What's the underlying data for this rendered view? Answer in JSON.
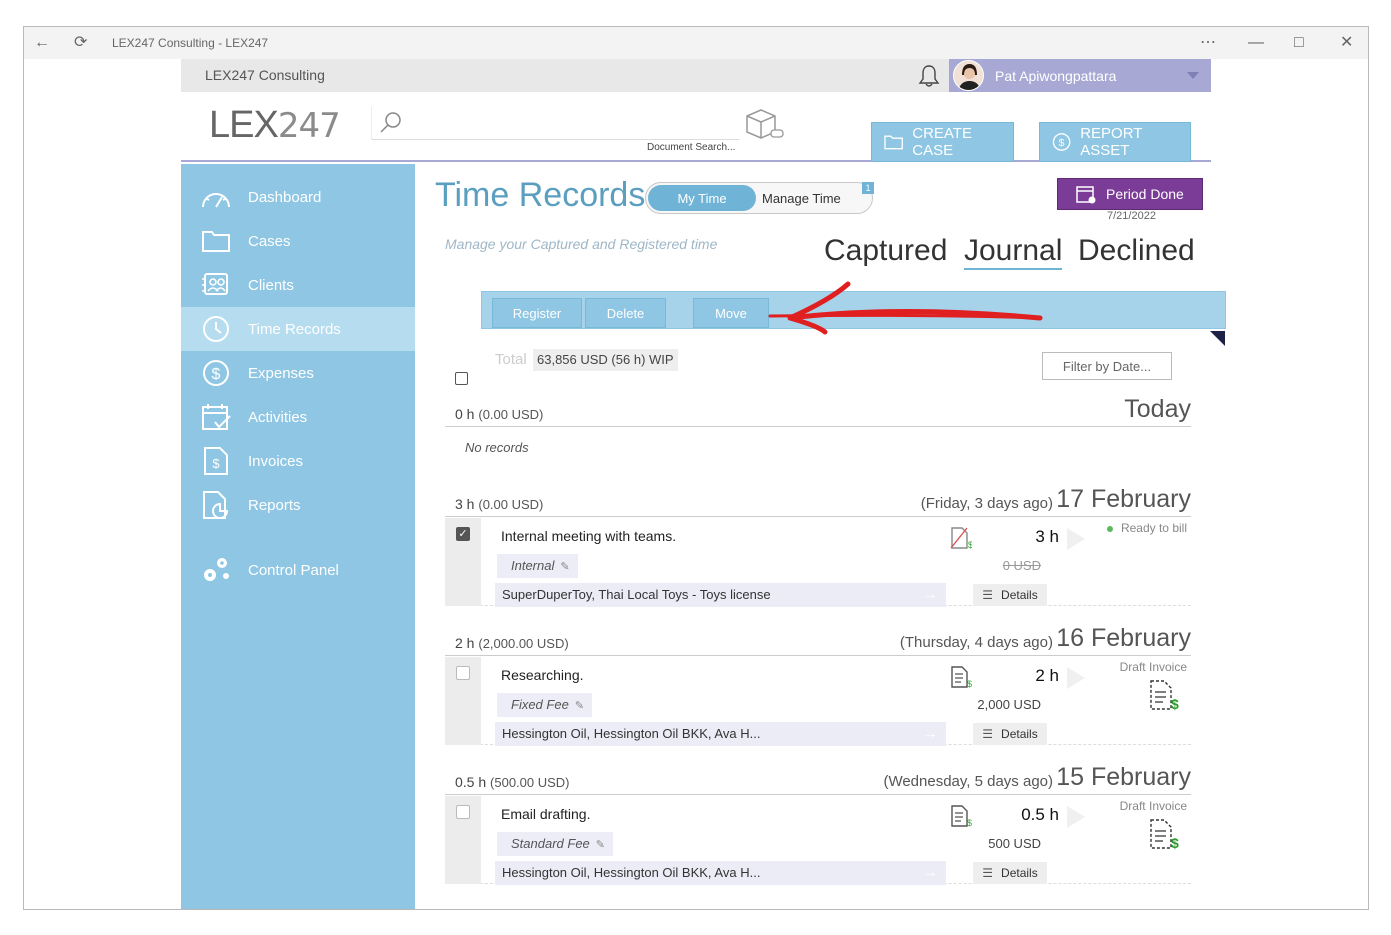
{
  "window": {
    "title": "LEX247 Consulting - LEX247"
  },
  "topbar": {
    "firm": "LEX247 Consulting",
    "user_name": "Pat Apiwongpattara"
  },
  "header": {
    "logo_bold": "LEX",
    "logo_light": "247",
    "search_placeholder": "",
    "doc_search_label": "Document Search...",
    "create_case": "CREATE CASE",
    "report_asset": "REPORT ASSET"
  },
  "sidebar": {
    "items": [
      {
        "label": "Dashboard",
        "icon": "gauge-icon"
      },
      {
        "label": "Cases",
        "icon": "folder-icon"
      },
      {
        "label": "Clients",
        "icon": "contacts-icon"
      },
      {
        "label": "Time Records",
        "icon": "clock-icon",
        "active": true
      },
      {
        "label": "Expenses",
        "icon": "dollar-icon"
      },
      {
        "label": "Activities",
        "icon": "calendar-icon"
      },
      {
        "label": "Invoices",
        "icon": "invoice-icon"
      },
      {
        "label": "Reports",
        "icon": "report-icon"
      },
      {
        "label": "Control Panel",
        "icon": "gears-icon"
      }
    ]
  },
  "main": {
    "title": "Time Records",
    "toggle": {
      "my_time": "My Time",
      "manage_time": "Manage Time",
      "badge": "1"
    },
    "period_done": {
      "label": "Period Done",
      "date": "7/21/2022"
    },
    "subtitle": "Manage your Captured and Registered time",
    "view_tabs": {
      "captured": "Captured",
      "journal": "Journal",
      "declined": "Declined",
      "active": "Journal"
    },
    "actions": {
      "register": "Register",
      "delete": "Delete",
      "move": "Move"
    },
    "total": {
      "label": "Total",
      "value": "63,856 USD (56 h)  WIP"
    },
    "filter_label": "Filter by Date...",
    "days": [
      {
        "hours": "0 h",
        "usd": "(0.00 USD)",
        "when": "",
        "date": "Today",
        "no_records": "No records"
      },
      {
        "hours": "3 h",
        "usd": "(0.00 USD)",
        "when": "(Friday, 3 days ago)",
        "date": "17 February"
      },
      {
        "hours": "2 h",
        "usd": "(2,000.00 USD)",
        "when": "(Thursday, 4 days ago)",
        "date": "16 February"
      },
      {
        "hours": "0.5 h",
        "usd": "(500.00 USD)",
        "when": "(Wednesday, 5 days ago)",
        "date": "15 February"
      }
    ],
    "records": [
      {
        "description": "Internal meeting with teams.",
        "tag": "Internal",
        "client": "SuperDuperToy, Thai Local Toys - Toys license",
        "hours": "3 h",
        "amount": "0 USD",
        "status": "Ready to bill",
        "details": "Details",
        "checked": true
      },
      {
        "description": "Researching.",
        "tag": "Fixed Fee",
        "client": "Hessington Oil, Hessington Oil BKK, Ava H...",
        "hours": "2 h",
        "amount": "2,000 USD",
        "status": "Draft Invoice",
        "details": "Details",
        "checked": false
      },
      {
        "description": "Email drafting.",
        "tag": "Standard Fee",
        "client": "Hessington Oil, Hessington Oil BKK, Ava H...",
        "hours": "0.5 h",
        "amount": "500 USD",
        "status": "Draft Invoice",
        "details": "Details",
        "checked": false
      }
    ]
  },
  "colors": {
    "sidebar": "#8ec6e3",
    "accent": "#6fb3d6",
    "period_btn": "#7b3c98",
    "user_bar": "#a7a9d4",
    "annotation_arrow": "#e02020"
  }
}
